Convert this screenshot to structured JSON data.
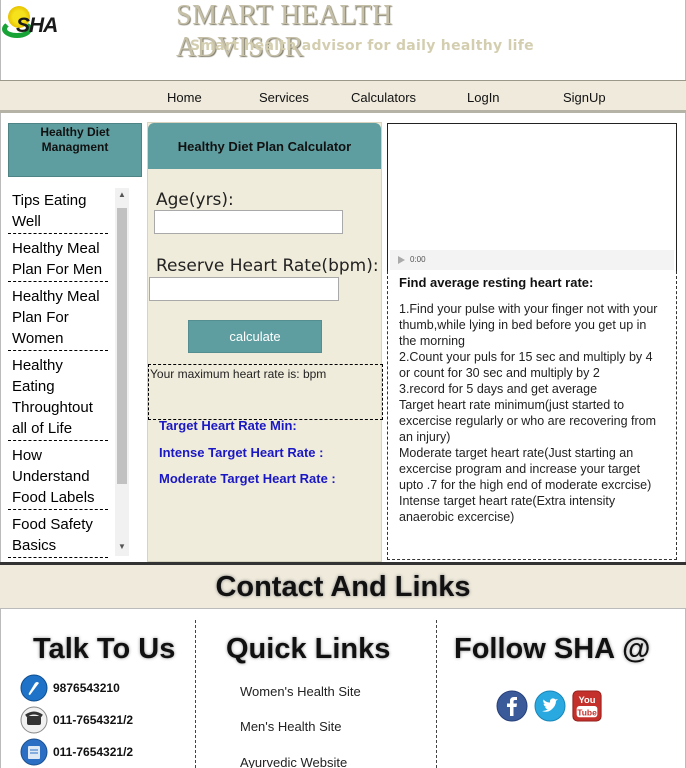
{
  "header": {
    "logo_text": "SHA",
    "title": "SMART HEALTH ADVISOR",
    "subtitle": "Smart health advisor for daily healthy life"
  },
  "nav": [
    "Home",
    "Services",
    "Calculators",
    "LogIn",
    "SignUp"
  ],
  "sidebar": {
    "heading": "Healthy Diet Managment",
    "items": [
      "Tips Eating Well",
      "Healthy Meal Plan For Men",
      "Healthy Meal Plan For Women",
      "Healthy Eating Throughtout all of Life",
      "How Understand Food Labels",
      "Food Safety Basics"
    ]
  },
  "calculator": {
    "heading": "Healthy Diet Plan Calculator",
    "age_label": "Age(yrs):",
    "hr_label": "Reserve Heart Rate(bpm):",
    "button": "calculate",
    "max_result": "Your maximum heart rate is: bpm",
    "target_min": "Target Heart Rate Min:",
    "target_intense": "Intense Target Heart Rate :",
    "target_moderate": "Moderate Target Heart Rate :"
  },
  "video": {
    "time": "0:00"
  },
  "info": {
    "title": "Find average resting heart rate:",
    "lines": [
      "1.Find your pulse with your finger not with your thumb,while lying in bed before you get up in the morning",
      "2.Count your puls for 15 sec and multiply by 4 or count for 30 sec and multiply by 2",
      "3.record for 5 days and get average",
      "Target heart rate minimum(just started to excercise regularly or who are recovering from an injury)",
      "Moderate target heart rate(Just starting an excercise program and increase your target upto .7 for the high end of moderate excrcise)",
      "Intense target heart rate(Extra intensity anaerobic excercise)"
    ]
  },
  "contact": {
    "heading": "Contact And Links",
    "talk_heading": "Talk To Us",
    "quick_heading": "Quick Links",
    "follow_heading": "Follow SHA @",
    "phones": [
      {
        "icon": "mobile-phone-icon",
        "value": "9876543210"
      },
      {
        "icon": "telephone-icon",
        "value": "011-7654321/2"
      },
      {
        "icon": "fax-icon",
        "value": "011-7654321/2"
      }
    ],
    "links": [
      "Women's Health Site",
      "Men's Health Site",
      "Ayurvedic Website"
    ],
    "social": [
      "facebook-icon",
      "twitter-icon",
      "youtube-icon"
    ]
  },
  "colors": {
    "teal": "#5f9ea0",
    "beige": "#efeadb",
    "target_blue": "#1a17c4"
  }
}
